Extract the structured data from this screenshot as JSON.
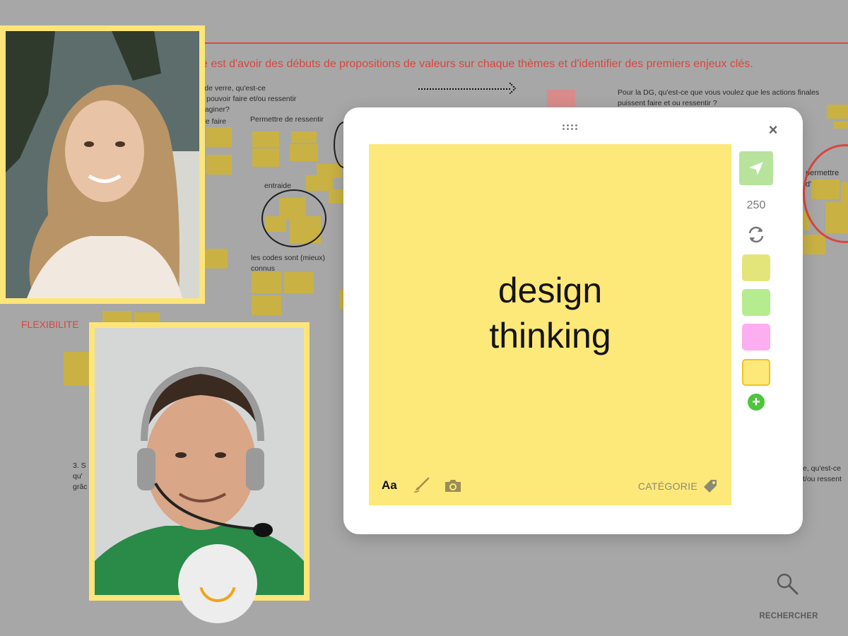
{
  "board": {
    "heading": "e est d'avoir des débuts de propositions de valeurs sur chaque thèmes et d'identifier des premiers enjeux clés.",
    "left_question": "l de verre, qu'est-ce\nit pouvoir faire et/ou ressentir\nnaginer?",
    "de_faire": "de faire",
    "permettre_ressentir": "Permettre de ressentir",
    "entraide": "entraide",
    "codes": "les codes sont (mieux)\nconnus",
    "flexibilite": "FLEXIBILITE",
    "dg_question": "Pour la DG, qu'est-ce que vous voulez que les actions finales\npuissent faire et ou ressentir ?",
    "permettre_right": "permettre d'a",
    "bottom_left": "3.  S\n   qu'\n  grâc",
    "bottom_right": "e, qu'est-ce\nt/ou ressent"
  },
  "modal": {
    "note_text": "design\nthinking",
    "font_label": "Aa",
    "category_label": "CATÉGORIE",
    "char_count": "250",
    "close_glyph": "×",
    "add_glyph": "+",
    "swatches": [
      "#e3e57a",
      "#b5ec8f",
      "#fdaef0",
      "#fde87a"
    ],
    "selected_swatch": "#fde87a",
    "send_color": "#b7e39d"
  },
  "search": {
    "label": "RECHERCHER"
  },
  "icons": {
    "send": "send-icon",
    "refresh": "refresh-icon",
    "brush": "brush-icon",
    "camera": "camera-icon",
    "tag": "tag-icon",
    "search": "search-icon"
  }
}
